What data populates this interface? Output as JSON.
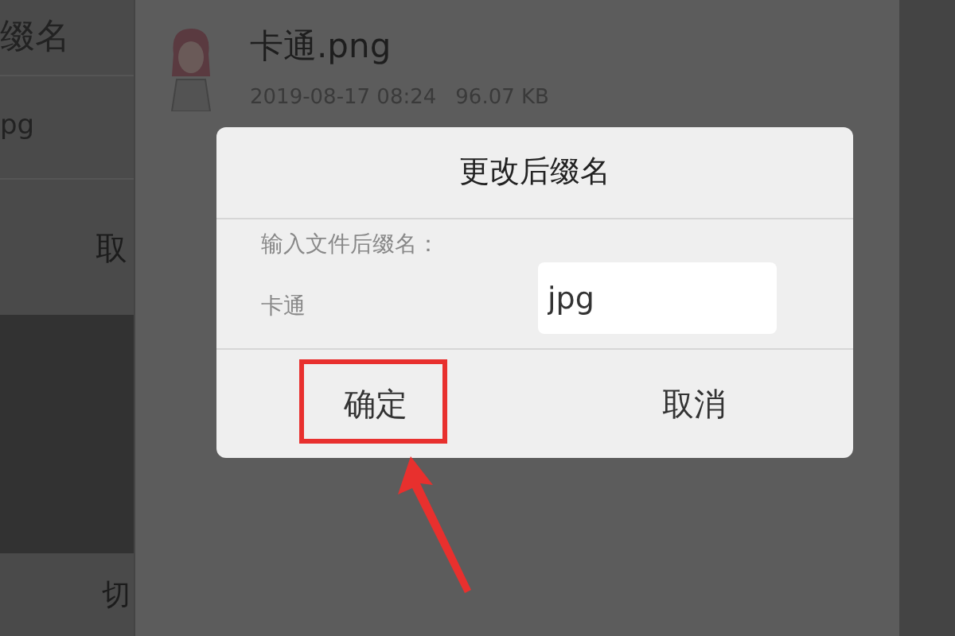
{
  "background_panel": {
    "texts": [
      "缀名",
      "pg",
      "取",
      "切"
    ]
  },
  "file": {
    "name": "卡通.png",
    "date": "2019-08-17 08:24",
    "size": "96.07 KB"
  },
  "dialog": {
    "title": "更改后缀名",
    "prompt": "输入文件后缀名：",
    "base_name": "卡通",
    "extension_value": "jpg",
    "buttons": [
      {
        "label": "确定",
        "highlighted": true
      },
      {
        "label": "取消",
        "highlighted": false
      }
    ]
  },
  "arrow_annotation": true
}
